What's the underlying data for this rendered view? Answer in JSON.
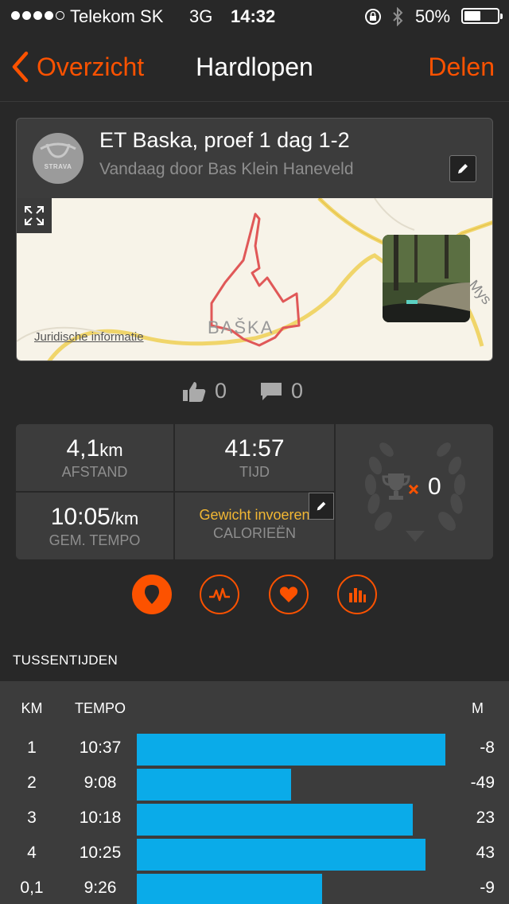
{
  "status_bar": {
    "signal_dots": 5,
    "signal_filled": 4,
    "carrier": "Telekom SK",
    "network": "3G",
    "time": "14:32",
    "battery_percent_text": "50%",
    "battery_level": 0.5
  },
  "nav": {
    "back_label": "Overzicht",
    "title": "Hardlopen",
    "share_label": "Delen"
  },
  "activity": {
    "avatar_text": "STRAVA",
    "title": "ET Baska, proef 1 dag 1-2",
    "subtitle": "Vandaag door Bas Klein Haneveld",
    "map": {
      "legal_link": "Juridische informatie",
      "place_label": "BAŠKA",
      "road_label": "Mys"
    }
  },
  "social": {
    "kudos_count": "0",
    "comment_count": "0"
  },
  "stats": {
    "distance": {
      "value": "4,1",
      "unit": "km",
      "label": "AFSTAND"
    },
    "time": {
      "value": "41:57",
      "label": "TIJD"
    },
    "pace": {
      "value": "10:05",
      "unit": "/km",
      "label": "GEM. TEMPO"
    },
    "calories": {
      "link": "Gewicht invoeren",
      "label": "CALORIEËN"
    },
    "achievements": {
      "count": "0"
    }
  },
  "tabs": [
    {
      "name": "map",
      "icon": "map-pin-icon",
      "active": true
    },
    {
      "name": "pace",
      "icon": "pulse-icon",
      "active": false
    },
    {
      "name": "heart",
      "icon": "heart-icon",
      "active": false
    },
    {
      "name": "splits",
      "icon": "bar-chart-icon",
      "active": false
    }
  ],
  "splits": {
    "section_title": "TUSSENTIJDEN",
    "headers": {
      "km": "KM",
      "pace": "TEMPO",
      "elev": "M"
    },
    "rows": [
      {
        "km": "1",
        "pace": "10:37",
        "pace_fraction": 1.0,
        "elev": "-8"
      },
      {
        "km": "2",
        "pace": "9:08",
        "pace_fraction": 0.5,
        "elev": "-49"
      },
      {
        "km": "3",
        "pace": "10:18",
        "pace_fraction": 0.895,
        "elev": "23"
      },
      {
        "km": "4",
        "pace": "10:25",
        "pace_fraction": 0.935,
        "elev": "43"
      },
      {
        "km": "0,1",
        "pace": "9:26",
        "pace_fraction": 0.6,
        "elev": "-9"
      }
    ]
  },
  "colors": {
    "accent": "#fc5200",
    "bar": "#0aabe9",
    "link_yellow": "#f2b733",
    "route": "#e05858"
  }
}
